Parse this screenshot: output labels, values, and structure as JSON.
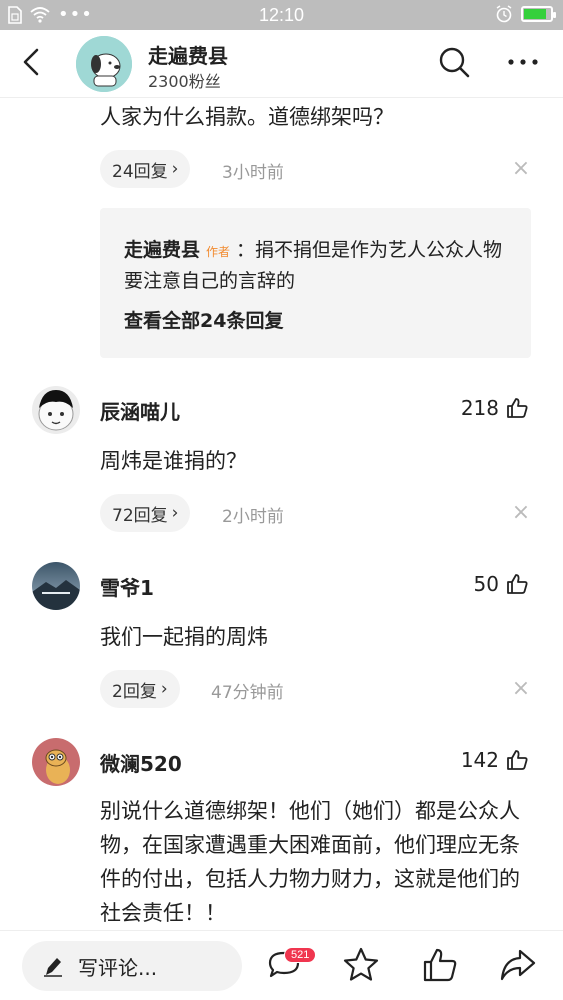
{
  "status_bar": {
    "time": "12:10"
  },
  "header": {
    "name": "走遍费县",
    "fans": "2300粉丝"
  },
  "top_comment_tail": {
    "text": "人家为什么捐款。道德绑架吗？",
    "replies_label": "24回复",
    "time": "3小时前",
    "author_reply": {
      "name": "走遍费县",
      "tag": "作者",
      "text": "：捐不捐但是作为艺人公众人物要注意自己的言辞的",
      "view_all": "查看全部24条回复"
    }
  },
  "comments": [
    {
      "name": "辰涵喵儿",
      "likes": "218",
      "text": "周炜是谁捐的？",
      "replies_label": "72回复",
      "time": "2小时前"
    },
    {
      "name": "雪爷1",
      "likes": "50",
      "text": "我们一起捐的周炜",
      "replies_label": "2回复",
      "time": "47分钟前"
    },
    {
      "name": "微澜520",
      "likes": "142",
      "text": "别说什么道德绑架！他们（她们）都是公众人物，在国家遭遇重大困难面前，他们理应无条件的付出，包括人力物力财力，这就是他们的社会责任！！"
    }
  ],
  "bottom_bar": {
    "placeholder": "写评论...",
    "comment_count": "521"
  }
}
